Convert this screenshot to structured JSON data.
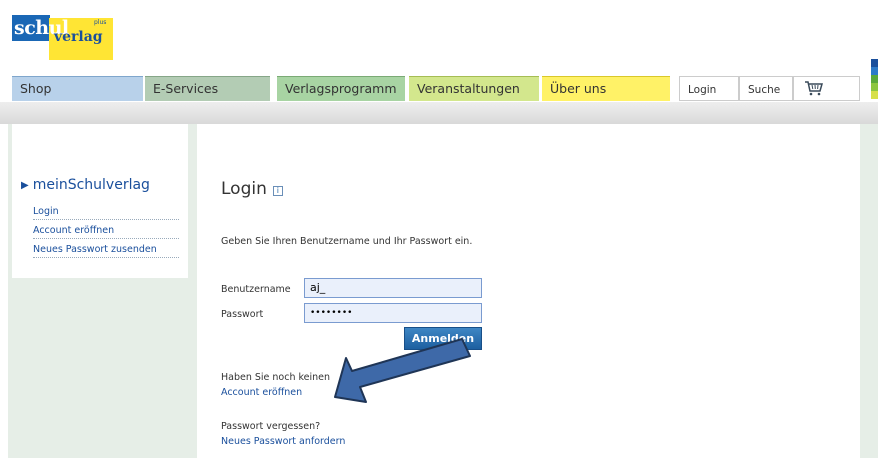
{
  "logo": {
    "word1": "schul",
    "word2": "verlag",
    "plus": "plus"
  },
  "nav": {
    "shop": "Shop",
    "eservices": "E-Services",
    "verlagsprogramm": "Verlagsprogramm",
    "veranstaltungen": "Veranstaltungen",
    "ueber": "Über uns"
  },
  "util": {
    "login": "Login",
    "suche": "Suche"
  },
  "sidebar": {
    "title": "meinSchulverlag",
    "items": [
      "Login",
      "Account eröffnen",
      "Neues Passwort zusenden"
    ]
  },
  "main": {
    "title": "Login",
    "intro": "Geben Sie Ihren Benutzername und Ihr Passwort ein.",
    "username_label": "Benutzername",
    "username_value": "aj_",
    "password_label": "Passwort",
    "password_value": "••••••••",
    "submit": "Anmelden",
    "no_account": "Haben Sie noch keinen",
    "create_account": "Account eröffnen",
    "forgot": "Passwort vergessen?",
    "request_password": "Neues Passwort anfordern"
  },
  "colors": {
    "brand_blue": "#1a67b5",
    "brand_yellow": "#ffe534",
    "link": "#1a4f9c",
    "button": "#1d5fa0"
  }
}
